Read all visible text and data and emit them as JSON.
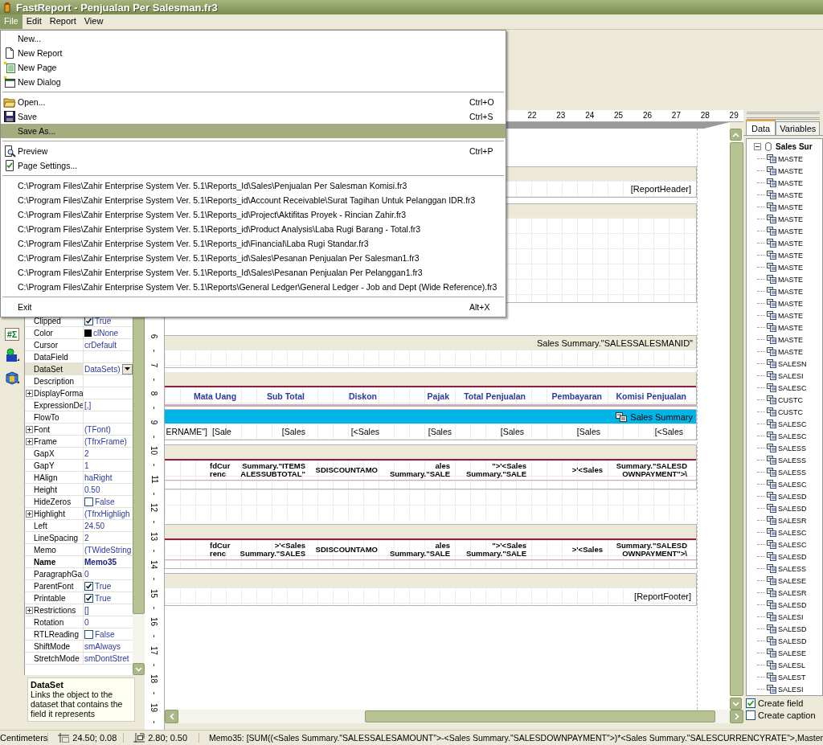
{
  "window": {
    "title": "FastReport - Penjualan Per Salesman.fr3"
  },
  "menubar": [
    {
      "label": "File",
      "selected": true
    },
    {
      "label": "Edit",
      "selected": false
    },
    {
      "label": "Report",
      "selected": false
    },
    {
      "label": "View",
      "selected": false
    }
  ],
  "file_menu": [
    {
      "kind": "item",
      "label": "New...",
      "selected": false
    },
    {
      "kind": "item",
      "label": "New Report",
      "selected": false
    },
    {
      "kind": "item",
      "label": "New Page",
      "selected": false
    },
    {
      "kind": "item",
      "label": "New Dialog",
      "selected": false
    },
    {
      "kind": "separator"
    },
    {
      "kind": "item",
      "label": "Open...",
      "shortcut": "Ctrl+O",
      "selected": false
    },
    {
      "kind": "item",
      "label": "Save",
      "shortcut": "Ctrl+S",
      "selected": false
    },
    {
      "kind": "item",
      "label": "Save As...",
      "selected": true
    },
    {
      "kind": "separator"
    },
    {
      "kind": "item",
      "label": "Preview",
      "shortcut": "Ctrl+P",
      "selected": false
    },
    {
      "kind": "item",
      "label": "Page Settings...",
      "selected": false
    },
    {
      "kind": "separator"
    },
    {
      "kind": "item",
      "label": "C:\\Program Files\\Zahir Enterprise System Ver. 5.1\\Reports_Id\\Sales\\Penjualan Per Salesman Komisi.fr3",
      "selected": false
    },
    {
      "kind": "item",
      "label": "C:\\Program Files\\Zahir Enterprise System Ver. 5.1\\Reports_id\\Account Receivable\\Surat Tagihan Untuk Pelanggan IDR.fr3",
      "selected": false
    },
    {
      "kind": "item",
      "label": "C:\\Program Files\\Zahir Enterprise System Ver. 5.1\\Reports_id\\Project\\Aktifitas Proyek - Rincian Zahir.fr3",
      "selected": false
    },
    {
      "kind": "item",
      "label": "C:\\Program Files\\Zahir Enterprise System Ver. 5.1\\Reports_id\\Product Analysis\\Laba Rugi Barang - Total.fr3",
      "selected": false
    },
    {
      "kind": "item",
      "label": "C:\\Program Files\\Zahir Enterprise System Ver. 5.1\\Reports_id\\Financial\\Laba Rugi Standar.fr3",
      "selected": false
    },
    {
      "kind": "item",
      "label": "C:\\Program Files\\Zahir Enterprise System Ver. 5.1\\Reports_id\\Sales\\Pesanan Penjualan Per Salesman1.fr3",
      "selected": false
    },
    {
      "kind": "item",
      "label": "C:\\Program Files\\Zahir Enterprise System Ver. 5.1\\Reports_Id\\Sales\\Pesanan Penjualan Per Pelanggan1.fr3",
      "selected": false
    },
    {
      "kind": "item",
      "label": "C:\\Program Files\\Zahir Enterprise System Ver. 5.1\\Reports\\General Ledger\\General Ledger - Job and Dept (Wide Reference).fr3",
      "selected": false
    },
    {
      "kind": "separator"
    },
    {
      "kind": "item",
      "label": "Exit",
      "shortcut": "Alt+X",
      "selected": false
    }
  ],
  "left_toolbar": {
    "aggregate_button": "#Σ"
  },
  "properties": [
    {
      "kind": "check",
      "name": "Clipped",
      "value": "True",
      "checked": true,
      "expandable": false,
      "bold": false,
      "selected": false
    },
    {
      "kind": "color",
      "name": "Color",
      "value": "clNone",
      "color": "#000000",
      "expandable": false,
      "bold": false,
      "selected": false
    },
    {
      "kind": "text",
      "name": "Cursor",
      "value": "crDefault",
      "expandable": false,
      "bold": false,
      "selected": false
    },
    {
      "kind": "text",
      "name": "DataField",
      "expandable": false,
      "bold": false,
      "selected": false
    },
    {
      "kind": "dropdown",
      "name": "DataSet",
      "value": "DataSets)",
      "expandable": false,
      "bold": false,
      "selected": true
    },
    {
      "kind": "text",
      "name": "Description",
      "expandable": false,
      "bold": false,
      "selected": false
    },
    {
      "kind": "text",
      "name": "DisplayForma",
      "expandable": true,
      "bold": false,
      "selected": false
    },
    {
      "kind": "text",
      "name": "ExpressionDe",
      "value": "[,]",
      "expandable": false,
      "bold": false,
      "selected": false
    },
    {
      "kind": "text",
      "name": "FlowTo",
      "expandable": false,
      "bold": false,
      "selected": false
    },
    {
      "kind": "text",
      "name": "Font",
      "value": "(TFont)",
      "expandable": true,
      "bold": false,
      "selected": false
    },
    {
      "kind": "text",
      "name": "Frame",
      "value": "(TfrxFrame)",
      "expandable": true,
      "bold": false,
      "selected": false
    },
    {
      "kind": "text",
      "name": "GapX",
      "value": "2",
      "expandable": false,
      "bold": false,
      "selected": false
    },
    {
      "kind": "text",
      "name": "GapY",
      "value": "1",
      "expandable": false,
      "bold": false,
      "selected": false
    },
    {
      "kind": "text",
      "name": "HAlign",
      "value": "haRight",
      "expandable": false,
      "bold": false,
      "selected": false
    },
    {
      "kind": "text",
      "name": "Height",
      "value": "0.50",
      "expandable": false,
      "bold": false,
      "selected": false
    },
    {
      "kind": "check",
      "name": "HideZeros",
      "value": "False",
      "checked": false,
      "expandable": false,
      "bold": false,
      "selected": false
    },
    {
      "kind": "text",
      "name": "Highlight",
      "value": "(TfrxHighligh",
      "expandable": true,
      "bold": false,
      "selected": false
    },
    {
      "kind": "text",
      "name": "Left",
      "value": "24.50",
      "expandable": false,
      "bold": false,
      "selected": false
    },
    {
      "kind": "text",
      "name": "LineSpacing",
      "value": "2",
      "expandable": false,
      "bold": false,
      "selected": false
    },
    {
      "kind": "text",
      "name": "Memo",
      "value": "(TWideString",
      "expandable": false,
      "bold": false,
      "selected": false
    },
    {
      "kind": "text",
      "name": "Name",
      "value": "Memo35",
      "expandable": false,
      "bold": true,
      "selected": false
    },
    {
      "kind": "text",
      "name": "ParagraphGa",
      "value": "0",
      "expandable": false,
      "bold": false,
      "selected": false
    },
    {
      "kind": "check",
      "name": "ParentFont",
      "value": "True",
      "checked": true,
      "expandable": false,
      "bold": false,
      "selected": false
    },
    {
      "kind": "check",
      "name": "Printable",
      "value": "True",
      "checked": true,
      "expandable": false,
      "bold": false,
      "selected": false
    },
    {
      "kind": "text",
      "name": "Restrictions",
      "value": "[]",
      "expandable": true,
      "bold": false,
      "selected": false
    },
    {
      "kind": "text",
      "name": "Rotation",
      "value": "0",
      "expandable": false,
      "bold": false,
      "selected": false
    },
    {
      "kind": "check",
      "name": "RTLReading",
      "value": "False",
      "checked": false,
      "expandable": false,
      "bold": false,
      "selected": false
    },
    {
      "kind": "text",
      "name": "ShiftMode",
      "value": "smAlways",
      "expandable": false,
      "bold": false,
      "selected": false
    },
    {
      "kind": "text",
      "name": "StretchMode",
      "value": "smDontStret",
      "expandable": false,
      "bold": false,
      "selected": false
    }
  ],
  "property_help": {
    "title": "DataSet",
    "text": "Links the object to the dataset that contains the field it represents"
  },
  "top_ruler": [
    "22",
    "23",
    "24",
    "25",
    "26",
    "27",
    "28",
    "29"
  ],
  "side_ruler": [
    "6",
    "7",
    "8",
    "9",
    "10",
    "11",
    "12",
    "13",
    "14",
    "15",
    "16",
    "17",
    "18",
    "19"
  ],
  "bands": [
    {
      "kind": "report_header",
      "label": "[ReportHeader]"
    },
    {
      "kind": "blank"
    },
    {
      "kind": "group_header",
      "caption": "Sales Summary.\"SALESSALESMANID\""
    },
    {
      "kind": "column_header",
      "columns": [
        "Mata Uang",
        "Sub Total",
        "Diskon",
        "Pajak",
        "Total Penjualan",
        "Pembayaran",
        "Komisi Penjualan"
      ]
    },
    {
      "kind": "master_data",
      "caption": "Sales Summary",
      "cells": [
        "ERNAME\"]",
        "[Sale",
        "[Sales",
        "[<Sales",
        "[Sales",
        "[Sales",
        "[Sales",
        "[<Sales"
      ]
    },
    {
      "kind": "summary",
      "cells": [
        [
          "fdCur",
          "renc"
        ],
        [
          "Summary.\"ITEMS",
          "ALESSUBTOTAL\""
        ],
        [
          "SDISCOUNTAMO"
        ],
        [
          "ales",
          "Summary.\"SALE"
        ],
        [
          "\">'<Sales",
          "Summary.\"SALE"
        ],
        [
          ">'<Sales"
        ],
        [
          "Summary.\"SALESD",
          "OWNPAYMENT\">\\"
        ]
      ]
    },
    {
      "kind": "gap"
    },
    {
      "kind": "summary",
      "cells": [
        [
          "fdCur",
          "renc"
        ],
        [
          ">'<Sales",
          "Summary.\"SALES"
        ],
        [
          "SDISCOUNTAMO"
        ],
        [
          "ales",
          "Summary.\"SALE"
        ],
        [
          "\">'<Sales",
          "Summary.\"SALE"
        ],
        [
          ">'<Sales"
        ],
        [
          "Summary.\"SALESD",
          "OWNPAYMENT\">\\"
        ]
      ]
    },
    {
      "kind": "report_footer",
      "label": "[ReportFooter]"
    }
  ],
  "data_panel": {
    "tabs": [
      {
        "label": "Data",
        "selected": true
      },
      {
        "label": "Variables",
        "selected": false
      }
    ],
    "tree": {
      "label": "Sales Sur",
      "expanded": true,
      "children": [
        {
          "label": "MASTE"
        },
        {
          "label": "MASTE"
        },
        {
          "label": "MASTE"
        },
        {
          "label": "MASTE"
        },
        {
          "label": "MASTE"
        },
        {
          "label": "MASTE"
        },
        {
          "label": "MASTE"
        },
        {
          "label": "MASTE"
        },
        {
          "label": "MASTE"
        },
        {
          "label": "MASTE"
        },
        {
          "label": "MASTE"
        },
        {
          "label": "MASTE"
        },
        {
          "label": "MASTE"
        },
        {
          "label": "MASTE"
        },
        {
          "label": "MASTE"
        },
        {
          "label": "MASTE"
        },
        {
          "label": "MASTE"
        },
        {
          "label": "SALESN"
        },
        {
          "label": "SALESI"
        },
        {
          "label": "SALESC"
        },
        {
          "label": "CUSTC"
        },
        {
          "label": "CUSTC"
        },
        {
          "label": "SALESC"
        },
        {
          "label": "SALESC"
        },
        {
          "label": "SALESS"
        },
        {
          "label": "SALESS"
        },
        {
          "label": "SALESS"
        },
        {
          "label": "SALESC"
        },
        {
          "label": "SALESD"
        },
        {
          "label": "SALESD"
        },
        {
          "label": "SALESR"
        },
        {
          "label": "SALESC"
        },
        {
          "label": "SALESC"
        },
        {
          "label": "SALESD"
        },
        {
          "label": "SALESS"
        },
        {
          "label": "SALESE"
        },
        {
          "label": "SALESR"
        },
        {
          "label": "SALESD"
        },
        {
          "label": "SALESI"
        },
        {
          "label": "SALESD"
        },
        {
          "label": "SALESD"
        },
        {
          "label": "SALESE"
        },
        {
          "label": "SALESL"
        },
        {
          "label": "SALEST"
        },
        {
          "label": "SALESI"
        }
      ]
    },
    "options": [
      {
        "label": "Create field",
        "checked": true
      },
      {
        "label": "Create caption",
        "checked": false
      }
    ]
  },
  "status_bar": {
    "units": "Centimeters",
    "position": "24.50; 0.08",
    "size": "2.80; 0.50",
    "expression": "Memo35: [SUM((<Sales Summary.\"SALESSALESAMOUNT\">-<Sales Summary.\"SALESDOWNPAYMENT\">)*<Sales Summary.\"SALESCURRENCYRATE\">,Master"
  }
}
